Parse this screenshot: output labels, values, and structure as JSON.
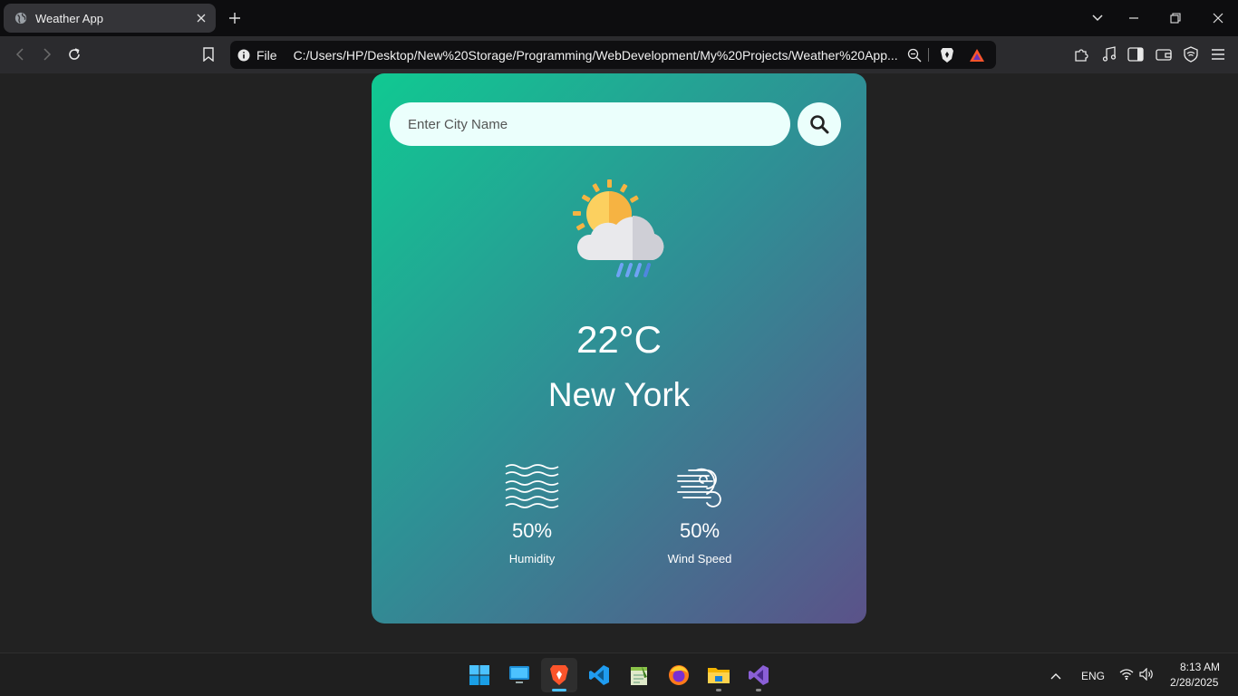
{
  "browser": {
    "tab": {
      "title": "Weather App"
    },
    "url": {
      "scheme_label": "File",
      "path": "C:/Users/HP/Desktop/New%20Storage/Programming/WebDevelopment/My%20Projects/Weather%20App..."
    }
  },
  "weather": {
    "search": {
      "placeholder": "Enter City Name"
    },
    "condition_icon": "sun-cloud-rain-icon",
    "temperature": "22°C",
    "city": "New York",
    "humidity": {
      "value": "50%",
      "label": "Humidity",
      "icon": "waves-icon"
    },
    "wind": {
      "value": "50%",
      "label": "Wind Speed",
      "icon": "wind-icon"
    }
  },
  "colors": {
    "card_gradient_start": "#10c992",
    "card_gradient_end": "#5b5289",
    "page_background": "#222222",
    "taskbar_accent": "#4cc2ff"
  },
  "taskbar": {
    "apps": [
      "start",
      "desktop",
      "brave",
      "vscode",
      "notepad-plus-plus",
      "firefox",
      "file-explorer",
      "visual-studio"
    ],
    "language": "ENG",
    "time": "8:13 AM",
    "date": "2/28/2025"
  }
}
